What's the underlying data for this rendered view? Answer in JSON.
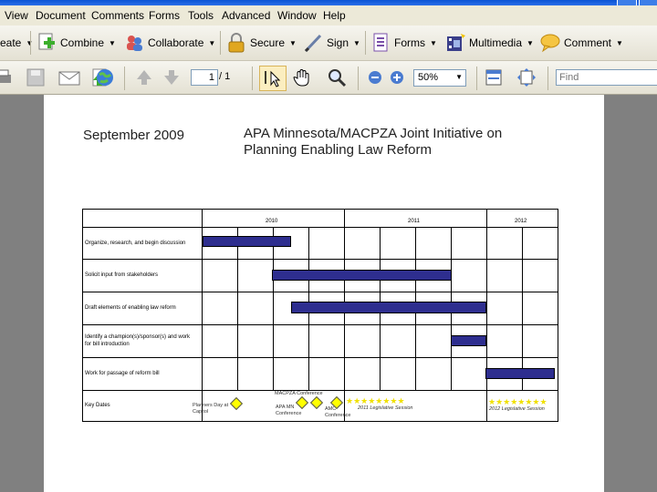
{
  "menu": [
    "View",
    "Document",
    "Comments",
    "Forms",
    "Tools",
    "Advanced",
    "Window",
    "Help"
  ],
  "toolbar1": {
    "create_partial": "eate",
    "combine": "Combine",
    "collaborate": "Collaborate",
    "secure": "Secure",
    "sign": "Sign",
    "forms": "Forms",
    "multimedia": "Multimedia",
    "comment": "Comment"
  },
  "toolbar2": {
    "page_current": "1",
    "page_total": "/ 1",
    "zoom": "50%",
    "find_placeholder": "Find"
  },
  "document": {
    "date": "September 2009",
    "title_line1": "APA Minnesota/MACPZA Joint Initiative on",
    "title_line2": "Planning Enabling Law Reform",
    "years": [
      "2010",
      "2011",
      "2012"
    ],
    "tasks": [
      "Organize, research, and begin discussion",
      "Solicit input from stakeholders",
      "Draft elements of enabling law reform",
      "Identify a champion(s)/sponsor(s) and work for bill introduction",
      "Work for passage of reform bill",
      "Key Dates"
    ],
    "key_dates": {
      "planners_day": "Planners Day at Capitol",
      "macpza": "MACPZA Conference",
      "apa_mn": "APA MN Conference",
      "amc": "AMC Conference",
      "session_2011": "2011 Legislative Session",
      "session_2012": "2012 Legislative Session"
    }
  },
  "colors": {
    "bar": "#2e2e8f",
    "diamond": "#ffff00",
    "star": "#f0e000"
  }
}
